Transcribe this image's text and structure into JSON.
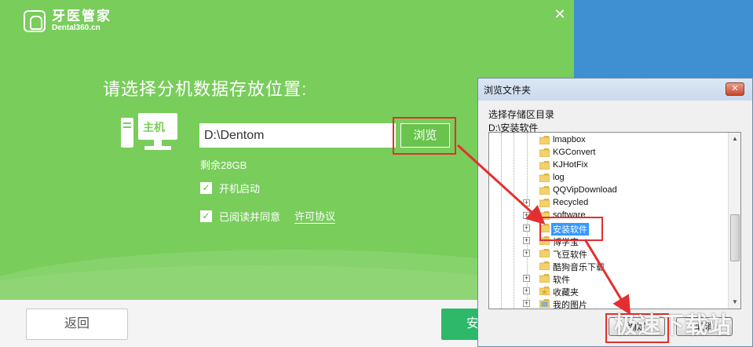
{
  "installer": {
    "logo_cn": "牙医管家",
    "logo_en": "Dental360.cn",
    "heading": "请选择分机数据存放位置:",
    "host_label": "主机",
    "path_value": "D:\\Dentom",
    "browse_label": "浏览",
    "free_space": "剩余28GB",
    "autostart_label": "开机启动",
    "agree_label": "已阅读并同意",
    "license_link": "许可协议",
    "back_label": "返回",
    "install_label": "安",
    "close_icon": "close-icon"
  },
  "dialog": {
    "title": "浏览文件夹",
    "prompt": "选择存储区目录",
    "current_path": "D:\\安装软件",
    "close_label": "✕",
    "tree_items": [
      {
        "label": "lmapbox",
        "expandable": false,
        "selected": false,
        "icon": "folder-icon"
      },
      {
        "label": "KGConvert",
        "expandable": false,
        "selected": false,
        "icon": "folder-icon"
      },
      {
        "label": "KJHotFix",
        "expandable": false,
        "selected": false,
        "icon": "folder-icon"
      },
      {
        "label": "log",
        "expandable": false,
        "selected": false,
        "icon": "folder-icon"
      },
      {
        "label": "QQVipDownload",
        "expandable": false,
        "selected": false,
        "icon": "folder-icon"
      },
      {
        "label": "Recycled",
        "expandable": true,
        "selected": false,
        "icon": "folder-icon"
      },
      {
        "label": "software",
        "expandable": true,
        "selected": false,
        "icon": "folder-icon"
      },
      {
        "label": "安装软件",
        "expandable": true,
        "selected": true,
        "icon": "folder-icon"
      },
      {
        "label": "博学宝",
        "expandable": true,
        "selected": false,
        "icon": "folder-icon"
      },
      {
        "label": "飞豆软件",
        "expandable": true,
        "selected": false,
        "icon": "folder-icon"
      },
      {
        "label": "酷狗音乐下载",
        "expandable": false,
        "selected": false,
        "icon": "folder-icon"
      },
      {
        "label": "软件",
        "expandable": true,
        "selected": false,
        "icon": "folder-icon"
      },
      {
        "label": "收藏夹",
        "expandable": true,
        "selected": false,
        "icon": "favorites-folder-icon"
      },
      {
        "label": "我的图片",
        "expandable": true,
        "selected": false,
        "icon": "pictures-folder-icon"
      }
    ],
    "ok_label": "确定",
    "cancel_label": "取消"
  },
  "watermark": "极速下载站",
  "colors": {
    "installer_green": "#79cd5b",
    "install_button": "#2db86a",
    "highlight_red": "#e32f2f",
    "selection_blue": "#3399ff",
    "desktop_blue": "#3f8fd3"
  }
}
